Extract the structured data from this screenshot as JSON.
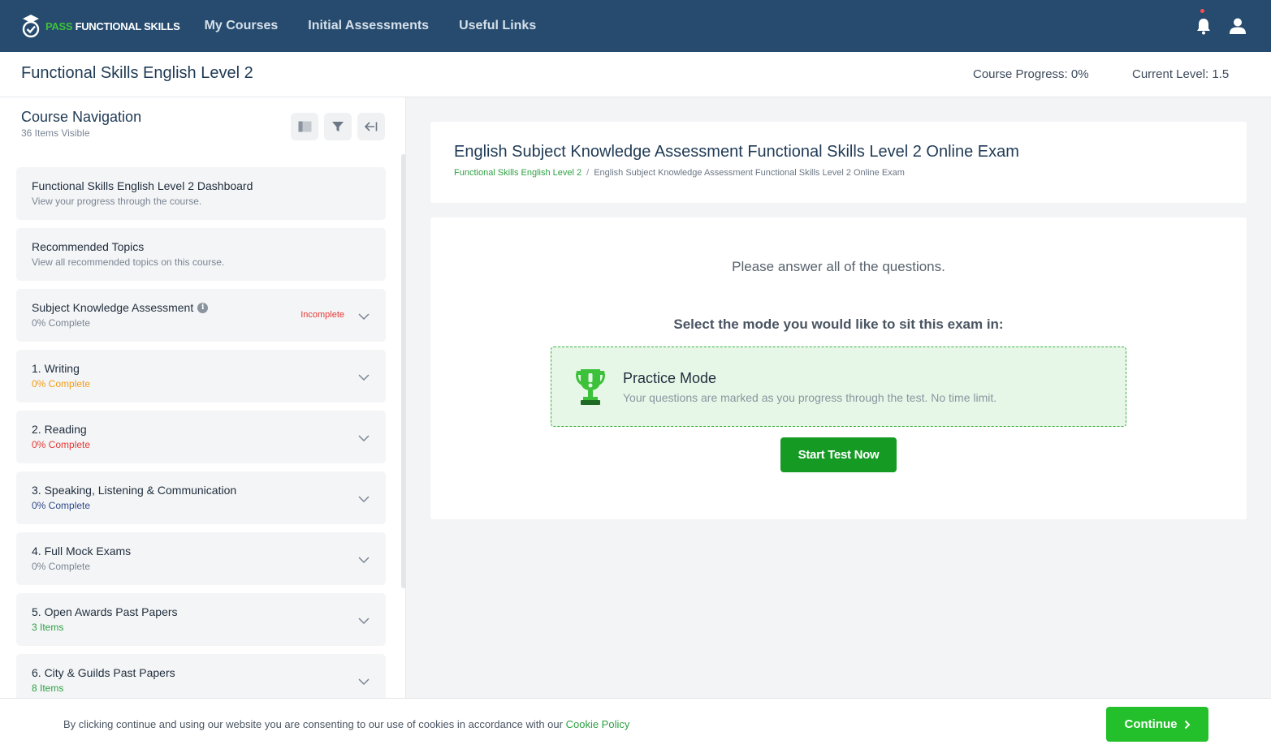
{
  "app": {
    "logo_accent": "PASS",
    "logo_main": "FUNCTIONAL SKILLS",
    "nav_links": [
      "My Courses",
      "Initial Assessments",
      "Useful Links"
    ],
    "icons": {
      "notification": "bell-icon",
      "account": "user-icon"
    }
  },
  "course": {
    "title": "Functional Skills English Level 2",
    "progress_label": "Course Progress:",
    "progress_value": "0%",
    "level_label": "Current Level:",
    "level_value": "1.5"
  },
  "sidebar": {
    "title": "Course Navigation",
    "subtitle": "36 Items Visible",
    "items": [
      {
        "title": "Functional Skills English Level 2 Dashboard",
        "subtitle": "View your progress through the course.",
        "subtitle_color": "#7a8594",
        "expandable": false,
        "status": "",
        "info": false
      },
      {
        "title": "Recommended Topics",
        "subtitle": "View all recommended topics on this course.",
        "subtitle_color": "#7a8594",
        "expandable": false,
        "status": "",
        "info": false
      },
      {
        "title": "Subject Knowledge Assessment",
        "subtitle": "0% Complete",
        "subtitle_color": "#7a8594",
        "expandable": true,
        "status": "Incomplete",
        "info": true
      },
      {
        "title": "1. Writing",
        "subtitle": "0% Complete",
        "subtitle_color": "#f39c12",
        "expandable": true,
        "status": "",
        "info": false
      },
      {
        "title": "2. Reading",
        "subtitle": "0% Complete",
        "subtitle_color": "#e53935",
        "expandable": true,
        "status": "",
        "info": false
      },
      {
        "title": "3. Speaking, Listening & Communication",
        "subtitle": "0% Complete",
        "subtitle_color": "#2f4a8a",
        "expandable": true,
        "status": "",
        "info": false
      },
      {
        "title": "4. Full Mock Exams",
        "subtitle": "0% Complete",
        "subtitle_color": "#7a8594",
        "expandable": true,
        "status": "",
        "info": false
      },
      {
        "title": "5. Open Awards Past Papers",
        "subtitle": "3 Items",
        "subtitle_color": "#2ea043",
        "expandable": true,
        "status": "",
        "info": false
      },
      {
        "title": "6. City & Guilds Past Papers",
        "subtitle": "8 Items",
        "subtitle_color": "#2ea043",
        "expandable": true,
        "status": "",
        "info": false
      }
    ]
  },
  "main": {
    "exam_title": "English Subject Knowledge Assessment Functional Skills Level 2 Online Exam",
    "breadcrumb_link": "Functional Skills English Level 2",
    "breadcrumb_sep": "/",
    "breadcrumb_current": "English Subject Knowledge Assessment Functional Skills Level 2 Online Exam",
    "instruction": "Please answer all of the questions.",
    "select_prompt": "Select the mode you would like to sit this exam in:",
    "mode": {
      "title": "Practice Mode",
      "description": "Your questions are marked as you progress through the test. No time limit.",
      "icon": "trophy-icon"
    },
    "start_button": "Start Test Now"
  },
  "cookie": {
    "text": "By clicking continue and using our website you are consenting to our use of cookies in accordance with our",
    "link": "Cookie Policy",
    "button": "Continue"
  },
  "colors": {
    "nav_bg": "#264b6e",
    "brand_green": "#3cc13b",
    "start_button": "#159a24",
    "continue_button": "#23c02b"
  }
}
